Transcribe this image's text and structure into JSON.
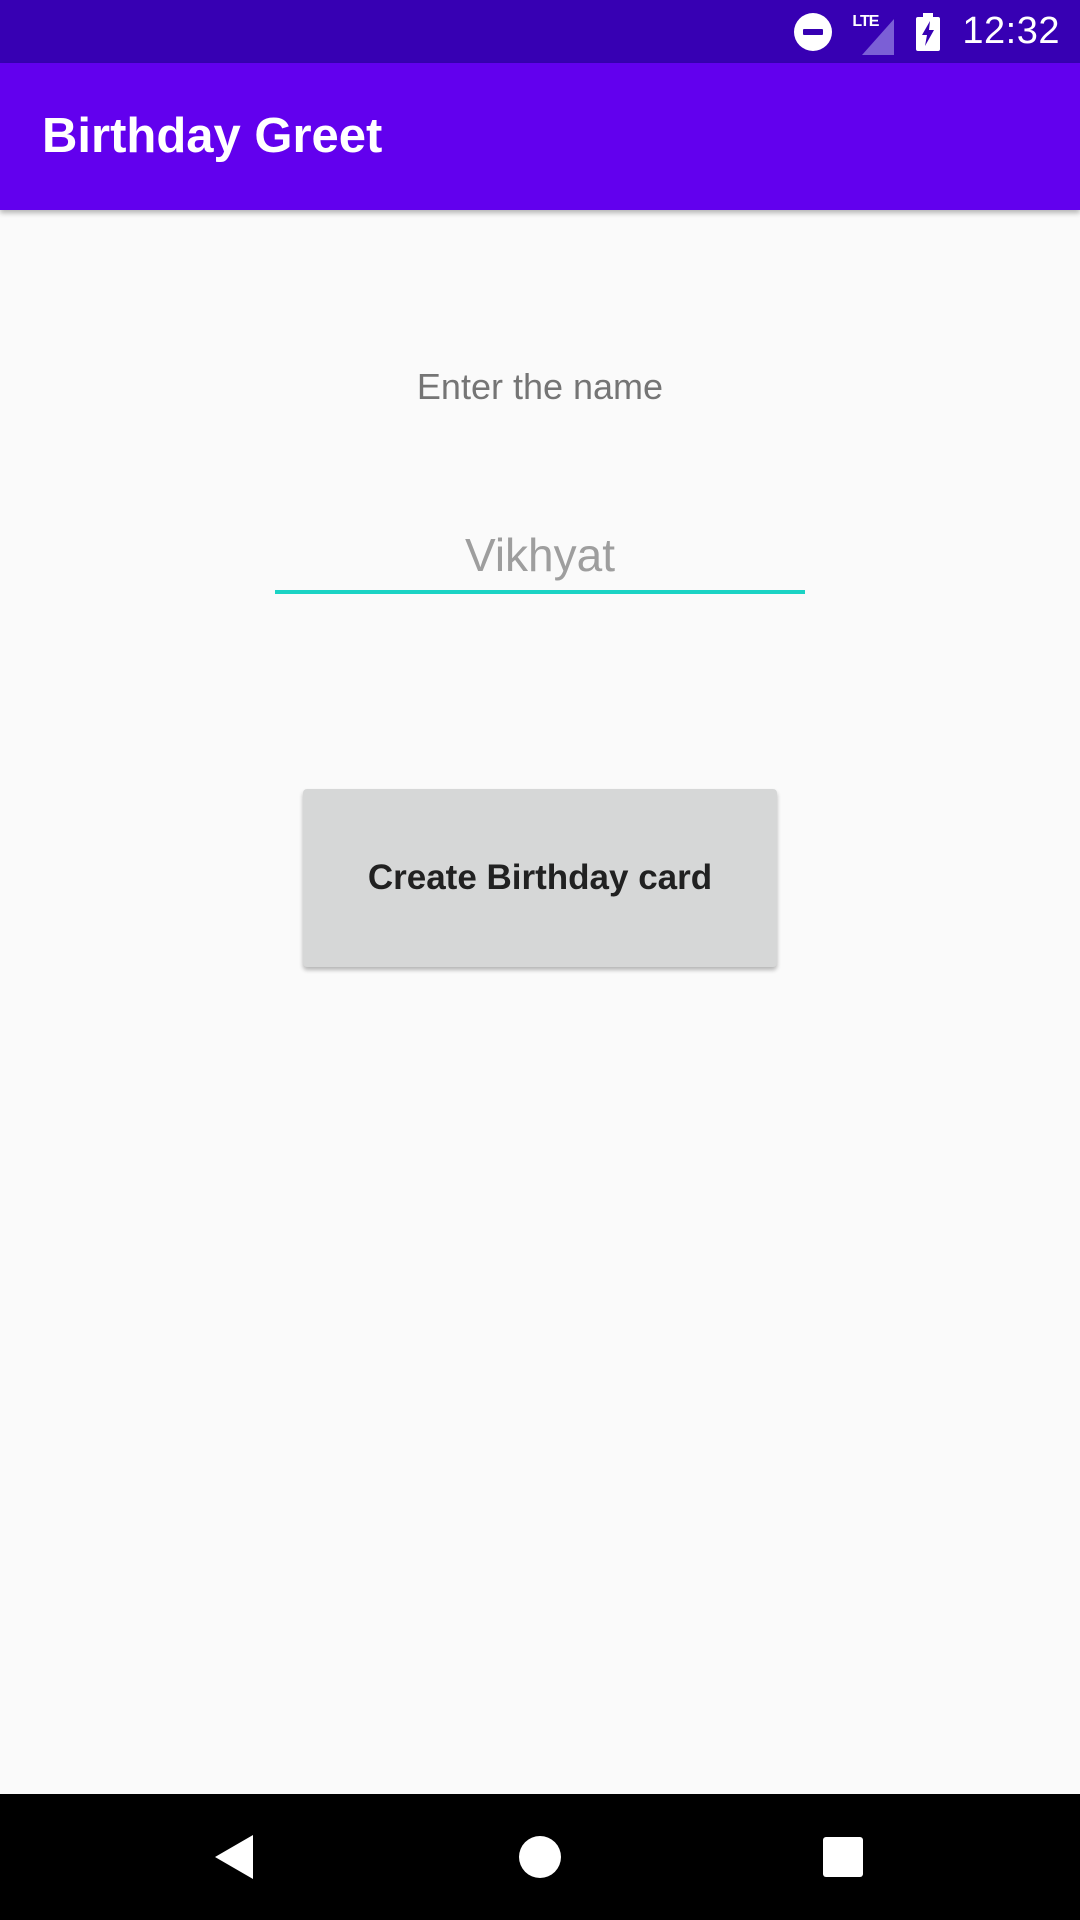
{
  "status_bar": {
    "network_label": "LTE",
    "time": "12:32",
    "background_color": "#3700b3",
    "icons": [
      "do-not-disturb-icon",
      "lte-signal-icon",
      "battery-charging-icon"
    ]
  },
  "app_bar": {
    "title": "Birthday Greet",
    "background_color": "#6200ee"
  },
  "form": {
    "label": "Enter the name",
    "name_input": {
      "value": "",
      "placeholder": "Vikhyat",
      "underline_color": "#1bd3c4"
    },
    "create_button_label": "Create Birthday card"
  },
  "nav_bar": {
    "icons": [
      "back-icon",
      "home-icon",
      "recents-icon"
    ]
  }
}
